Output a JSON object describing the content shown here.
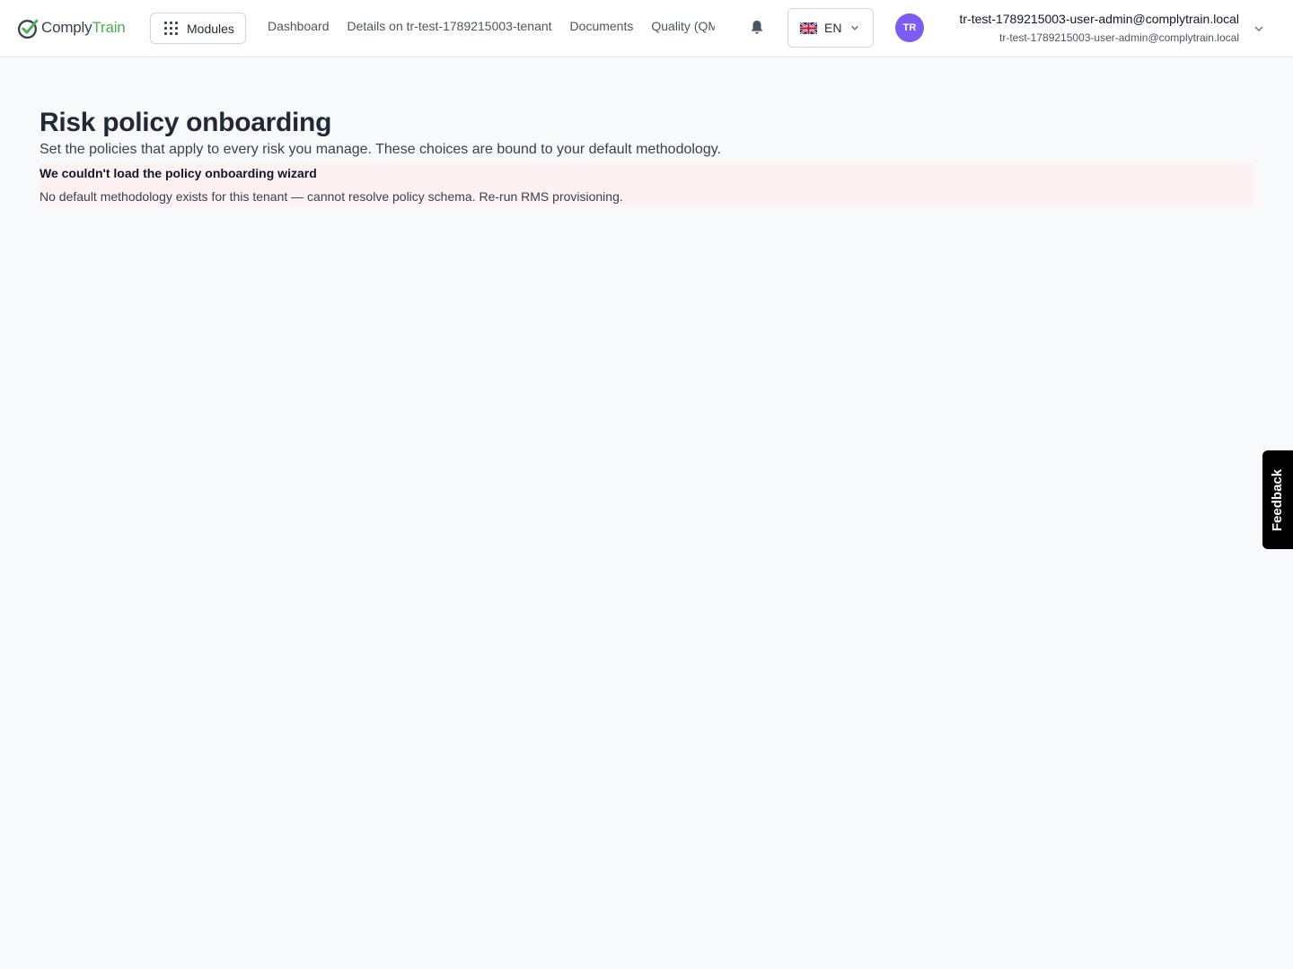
{
  "header": {
    "logo": {
      "part1": "Comply",
      "part2": "Train",
      "check_color": "#374151",
      "brand_color": "#4caf50"
    },
    "modules_button": {
      "label": "Modules",
      "icon": "grid-icon"
    },
    "nav": [
      {
        "label": "Dashboard"
      },
      {
        "label": "Details on tr-test-1789215003-tenant"
      },
      {
        "label": "Documents"
      },
      {
        "label": "Quality (QM"
      }
    ],
    "notifications_icon": "bell-icon",
    "language": {
      "code": "EN",
      "flag": "uk-flag-icon"
    },
    "user": {
      "initials": "TR",
      "avatar_color": "#7c5cf2",
      "name": "tr-test-1789215003-user-admin@complytrain.local",
      "email": "tr-test-1789215003-user-admin@complytrain.local"
    }
  },
  "main": {
    "title": "Risk policy onboarding",
    "subtitle": "Set the policies that apply to every risk you manage. These choices are bound to your default methodology.",
    "error": {
      "title": "We couldn't load the policy onboarding wizard",
      "message": "No default methodology exists for this tenant — cannot resolve policy schema. Re-run RMS provisioning.",
      "background": "#fef1f1"
    }
  },
  "feedback_tab": {
    "label": "Feedback"
  }
}
